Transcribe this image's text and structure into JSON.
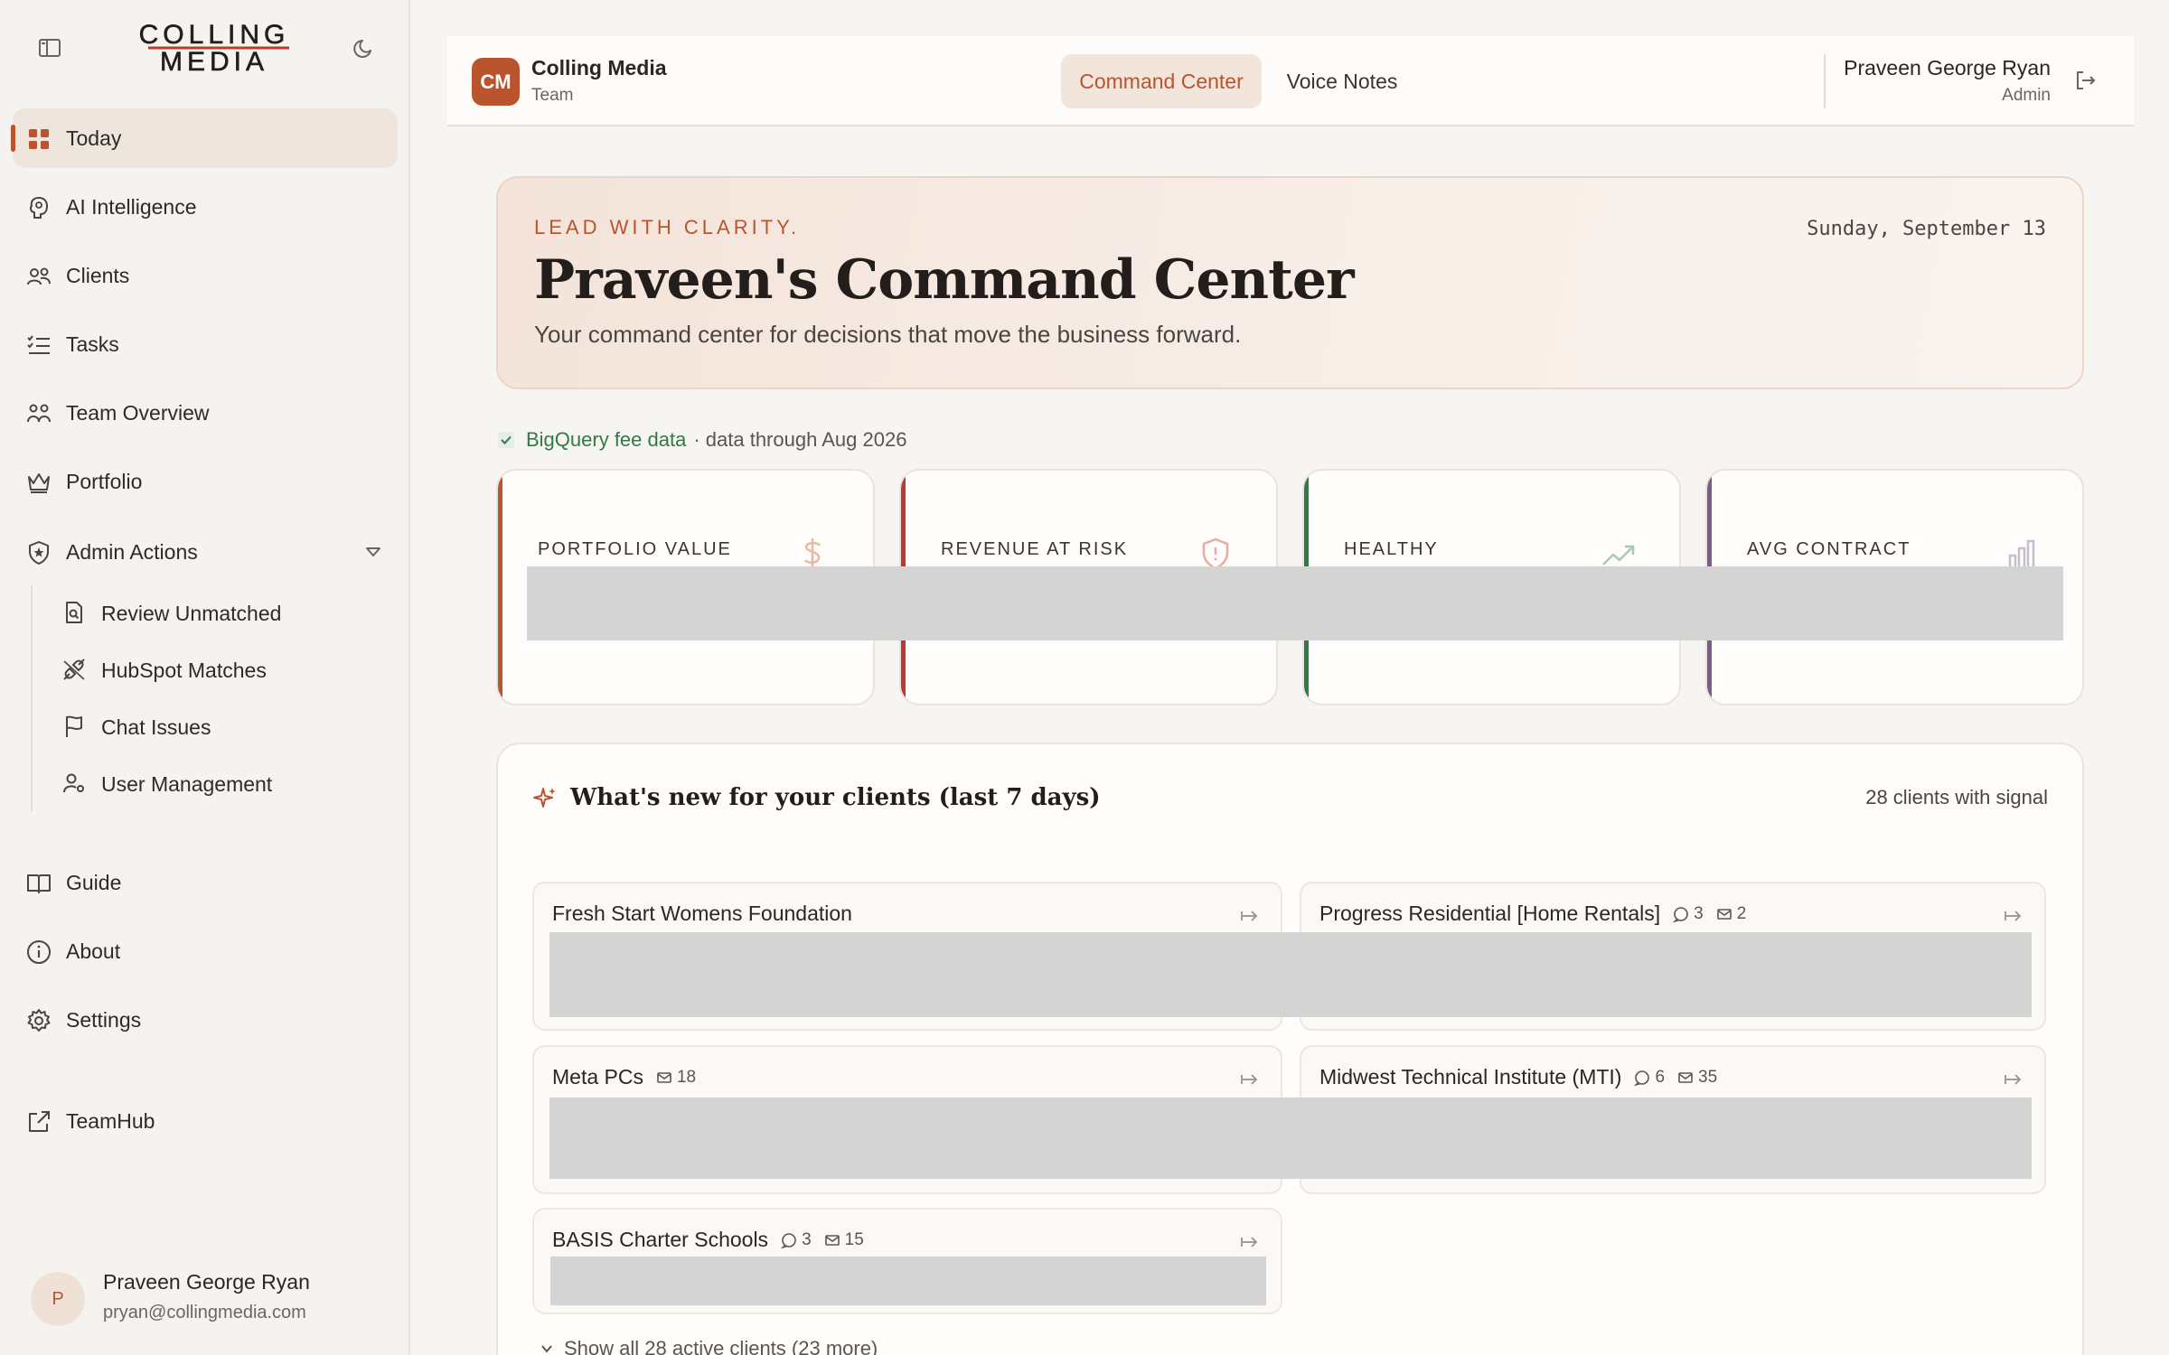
{
  "brand": {
    "logo_line1": "COLLING",
    "logo_line2": "MEDIA",
    "accent": "#b9542f"
  },
  "sidebar": {
    "items": [
      {
        "label": "Today",
        "icon": "grid-icon",
        "active": true
      },
      {
        "label": "AI Intelligence",
        "icon": "brain-icon"
      },
      {
        "label": "Clients",
        "icon": "users-icon"
      },
      {
        "label": "Tasks",
        "icon": "list-checks-icon"
      },
      {
        "label": "Team Overview",
        "icon": "team-icon"
      },
      {
        "label": "Portfolio",
        "icon": "crown-icon"
      },
      {
        "label": "Admin Actions",
        "icon": "shield-star-icon",
        "expanded": true
      }
    ],
    "admin_sub": [
      {
        "label": "Review Unmatched",
        "icon": "file-search-icon"
      },
      {
        "label": "HubSpot Matches",
        "icon": "unplug-icon"
      },
      {
        "label": "Chat Issues",
        "icon": "flag-icon"
      },
      {
        "label": "User Management",
        "icon": "user-cog-icon"
      }
    ],
    "bottom": [
      {
        "label": "Guide",
        "icon": "book-icon"
      },
      {
        "label": "About",
        "icon": "info-icon"
      },
      {
        "label": "Settings",
        "icon": "gear-icon"
      },
      {
        "label": "TeamHub",
        "icon": "external-link-icon"
      }
    ],
    "user": {
      "initial": "P",
      "name": "Praveen George Ryan",
      "email": "pryan@collingmedia.com"
    }
  },
  "header": {
    "org_initials": "CM",
    "org_name": "Colling Media",
    "org_sub": "Team",
    "tabs": [
      {
        "label": "Command Center",
        "active": true
      },
      {
        "label": "Voice Notes",
        "active": false
      }
    ],
    "user_name": "Praveen George Ryan",
    "user_role": "Admin"
  },
  "hero": {
    "eyebrow": "LEAD WITH CLARITY.",
    "title": "Praveen's Command Center",
    "subtitle": "Your command center for decisions that move the business forward.",
    "date": "Sunday, September 13"
  },
  "data_source": {
    "link": "BigQuery fee data",
    "rest": "· data through Aug 2026"
  },
  "kpis": [
    {
      "label": "PORTFOLIO VALUE",
      "icon": "dollar-icon",
      "color": "#b9542f"
    },
    {
      "label": "REVENUE AT RISK",
      "icon": "shield-alert-icon",
      "color": "#b83a32"
    },
    {
      "label": "HEALTHY",
      "icon": "trending-up-icon",
      "color": "#2f7a45"
    },
    {
      "label": "AVG CONTRACT",
      "icon": "bar-chart-icon",
      "color": "#7d5a8c"
    }
  ],
  "signals": {
    "title": "What's new for your clients (last 7 days)",
    "count": "28 clients with signal",
    "clients": [
      {
        "name": "Fresh Start Womens Foundation"
      },
      {
        "name": "Progress Residential [Home Rentals]",
        "chats": "3",
        "emails": "2"
      },
      {
        "name": "Meta PCs",
        "emails": "18"
      },
      {
        "name": "Midwest Technical Institute (MTI)",
        "chats": "6",
        "emails": "35"
      },
      {
        "name": "BASIS Charter Schools",
        "chats": "3",
        "emails": "15"
      }
    ],
    "show_all": "Show all 28 active clients (23 more)"
  }
}
